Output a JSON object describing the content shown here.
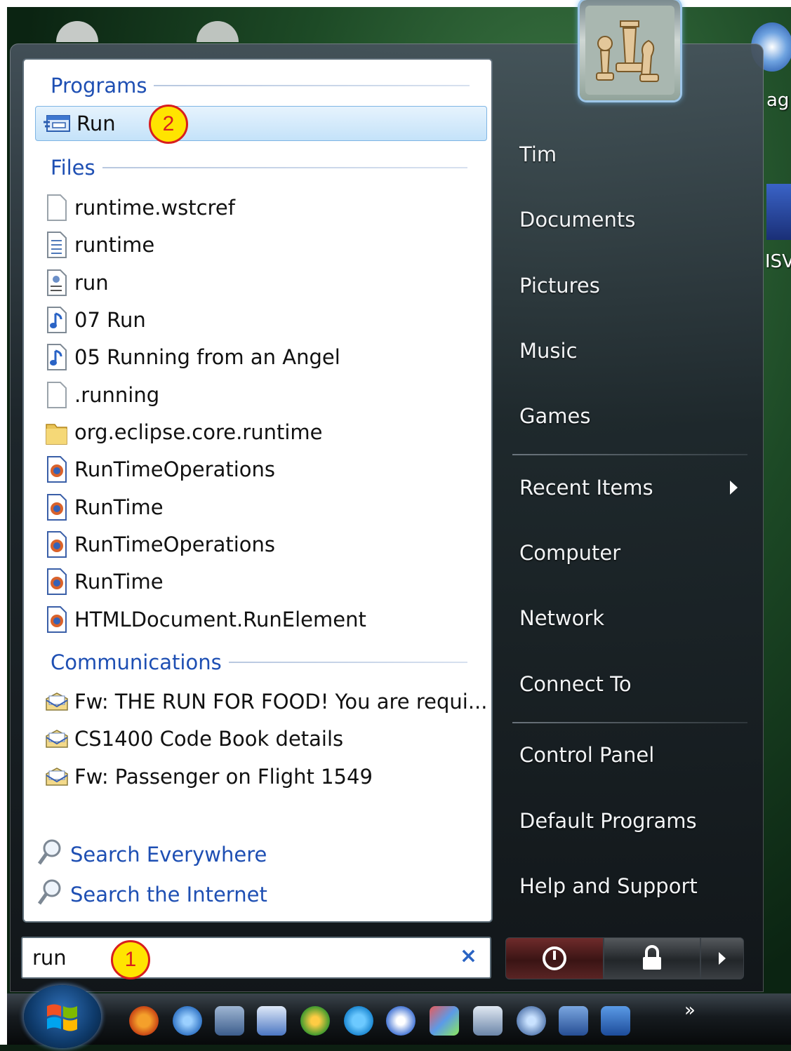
{
  "search": {
    "query": "run",
    "clear_glyph": "×"
  },
  "programs": {
    "header": "Programs",
    "items": [
      {
        "label": "Run",
        "icon": "run-dialog-icon"
      }
    ]
  },
  "files": {
    "header": "Files",
    "items": [
      {
        "label": "runtime.wstcref",
        "icon": "blank-file-icon"
      },
      {
        "label": "runtime",
        "icon": "text-file-icon"
      },
      {
        "label": "run",
        "icon": "script-file-icon"
      },
      {
        "label": "07 Run",
        "icon": "music-file-icon"
      },
      {
        "label": "05 Running from an Angel",
        "icon": "music-file-icon"
      },
      {
        "label": ".running",
        "icon": "blank-file-icon"
      },
      {
        "label": "org.eclipse.core.runtime",
        "icon": "folder-icon"
      },
      {
        "label": "RunTimeOperations",
        "icon": "firefox-document-icon"
      },
      {
        "label": "RunTime",
        "icon": "firefox-document-icon"
      },
      {
        "label": "RunTimeOperations",
        "icon": "firefox-document-icon"
      },
      {
        "label": "RunTime",
        "icon": "firefox-document-icon"
      },
      {
        "label": "HTMLDocument.RunElement",
        "icon": "firefox-document-icon"
      }
    ]
  },
  "communications": {
    "header": "Communications",
    "items": [
      {
        "label": "Fw: THE RUN FOR FOOD! You are requi...",
        "icon": "email-icon"
      },
      {
        "label": "CS1400 Code Book details",
        "icon": "email-icon"
      },
      {
        "label": "Fw: Passenger on Flight 1549",
        "icon": "email-icon"
      }
    ]
  },
  "search_links": {
    "everywhere": "Search Everywhere",
    "internet": "Search the Internet"
  },
  "right_pane": {
    "items": [
      "Tim",
      "Documents",
      "Pictures",
      "Music",
      "Games",
      "Recent Items",
      "Computer",
      "Network",
      "Connect To",
      "Control Panel",
      "Default Programs",
      "Help and Support"
    ]
  },
  "badges": {
    "step1": "1",
    "step2": "2"
  },
  "desktop": {
    "label_top": "ag",
    "label_mid": "ISV"
  },
  "taskbar": {
    "more_glyph": "»"
  },
  "colors": {
    "link_blue": "#1e4fb3",
    "highlight": "#c4e2f9",
    "badge_yellow": "#ffe400",
    "badge_red": "#d81e1e"
  }
}
